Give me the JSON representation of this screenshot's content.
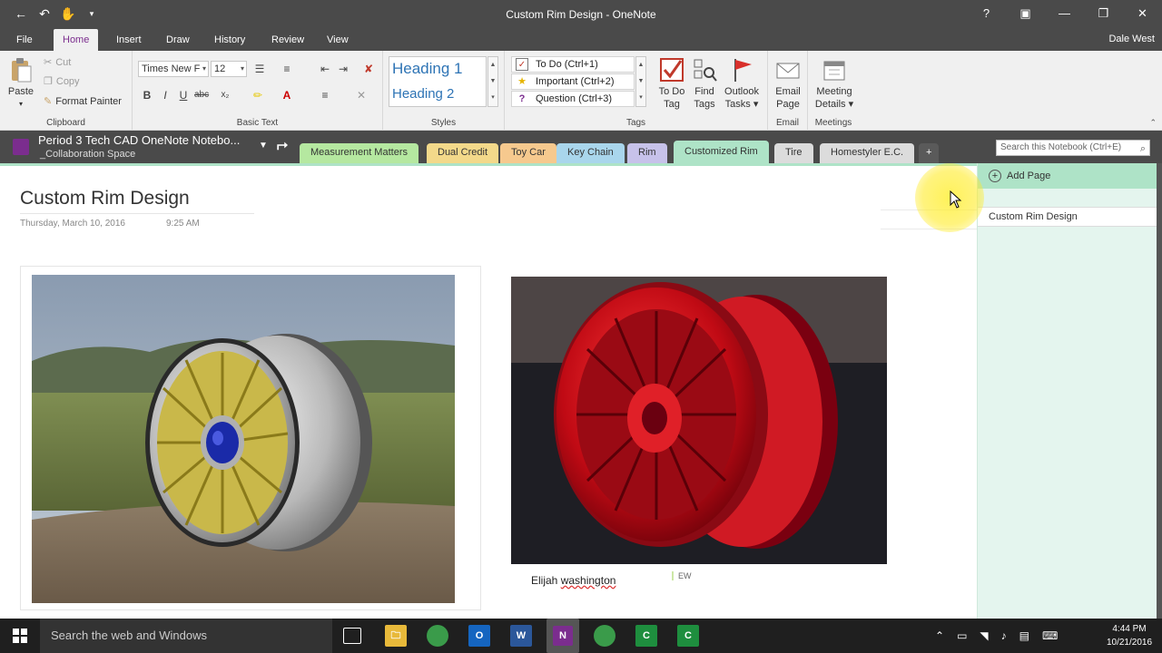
{
  "window": {
    "title": "Custom Rim Design - OneNote",
    "user": "Dale West"
  },
  "ribbon_tabs": [
    "File",
    "Home",
    "Insert",
    "Draw",
    "History",
    "Review",
    "View"
  ],
  "ribbon": {
    "clipboard": {
      "paste": "Paste",
      "cut": "Cut",
      "copy": "Copy",
      "format_painter": "Format Painter",
      "label": "Clipboard"
    },
    "basic_text": {
      "font_name": "Times New F",
      "font_size": "12",
      "label": "Basic Text"
    },
    "styles": {
      "heading1": "Heading 1",
      "heading2": "Heading 2",
      "label": "Styles"
    },
    "tags": {
      "items": [
        "To Do (Ctrl+1)",
        "Important (Ctrl+2)",
        "Question (Ctrl+3)"
      ],
      "todo_tag": [
        "To Do",
        "Tag"
      ],
      "find_tags": [
        "Find",
        "Tags"
      ],
      "outlook_tasks": [
        "Outlook",
        "Tasks"
      ],
      "label": "Tags"
    },
    "email": {
      "button": [
        "Email",
        "Page"
      ],
      "label": "Email"
    },
    "meetings": {
      "button": [
        "Meeting",
        "Details"
      ],
      "label": "Meetings"
    }
  },
  "notebook": {
    "name": "Period 3 Tech CAD OneNote Notebo...",
    "section_group": "_Collaboration Space",
    "sections": [
      {
        "label": "Measurement Matters",
        "color": "#b5e8a0"
      },
      {
        "label": "Dual Credit",
        "color": "#f3d98a"
      },
      {
        "label": "Toy Car",
        "color": "#f6c98e"
      },
      {
        "label": "Key Chain",
        "color": "#a9d6ec"
      },
      {
        "label": "Rim",
        "color": "#c7c2ea"
      },
      {
        "label": "Customized Rim",
        "color": "#aee3c7"
      },
      {
        "label": "Tire",
        "color": "#dcdcdc"
      },
      {
        "label": "Homestyler E.C.",
        "color": "#dcdcdc"
      }
    ],
    "add_section": "+",
    "search_placeholder": "Search this Notebook (Ctrl+E)"
  },
  "page": {
    "title": "Custom Rim Design",
    "date": "Thursday, March 10, 2016",
    "time": "9:25 AM",
    "caption_first": "Elijah",
    "caption_last": "washington",
    "author_initials": "EW"
  },
  "pagelist": {
    "add_page": "Add Page",
    "pages": [
      "Custom Rim Design"
    ]
  },
  "taskbar": {
    "search_placeholder": "Search the web and Windows",
    "clock_time": "4:44 PM",
    "clock_date": "10/21/2016"
  },
  "colors": {
    "onenote_purple": "#7b2d8e",
    "active_section": "#aee3c7",
    "dark_chrome": "#4a4a4a"
  }
}
